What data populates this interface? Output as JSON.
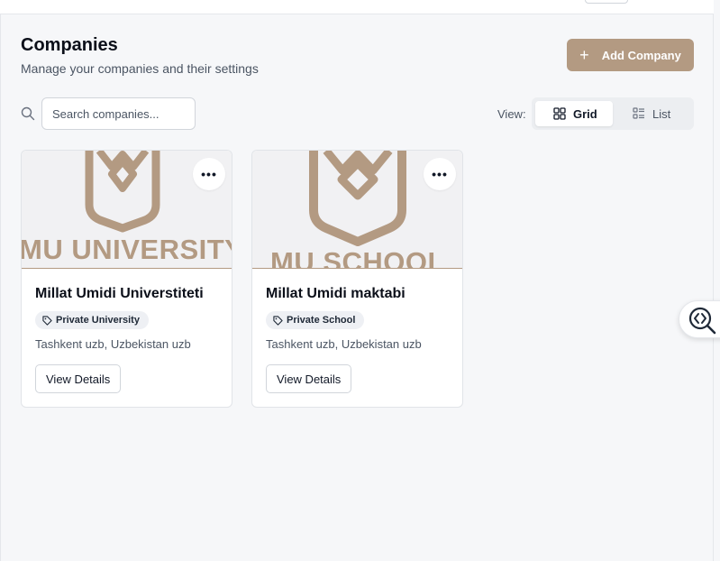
{
  "header": {
    "title": "Companies",
    "subtitle": "Manage your companies and their settings",
    "add_button_label": "Add Company"
  },
  "search": {
    "placeholder": "Search companies...",
    "value": ""
  },
  "view": {
    "label": "View:",
    "options": [
      "Grid",
      "List"
    ],
    "selected": "Grid"
  },
  "companies": [
    {
      "logo_text": "MU UNIVERSITY",
      "name": "Millat Umidi Universtiteti",
      "type": "Private University",
      "location": "Tashkent uzb, Uzbekistan uzb",
      "details_label": "View Details",
      "more_icon": "ellipsis-icon"
    },
    {
      "logo_text": "MU SCHOOL",
      "name": "Millat Umidi maktabi",
      "type": "Private School",
      "location": "Tashkent uzb, Uzbekistan uzb",
      "details_label": "View Details",
      "more_icon": "ellipsis-icon"
    }
  ],
  "colors": {
    "brand": "#b39a82",
    "background": "#f6f7f9",
    "card_bg": "#ffffff"
  }
}
